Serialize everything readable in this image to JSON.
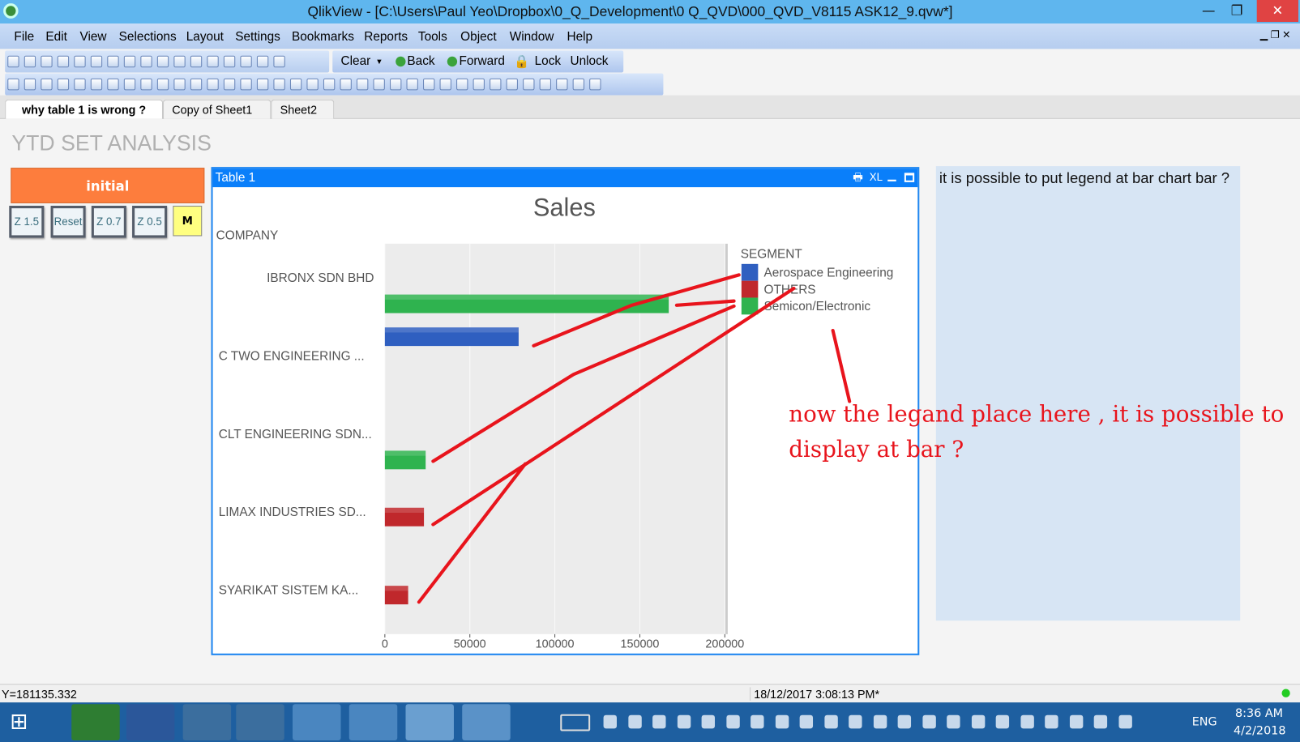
{
  "window": {
    "title": "QlikView - [C:\\Users\\Paul Yeo\\Dropbox\\0_Q_Development\\0 Q_QVD\\000_QVD_V8115 ASK12_9.qvw*]",
    "minimize": "—",
    "restore": "❐",
    "close": "✕"
  },
  "menu": [
    "File",
    "Edit",
    "View",
    "Selections",
    "Layout",
    "Settings",
    "Bookmarks",
    "Reports",
    "Tools",
    "Object",
    "Window",
    "Help"
  ],
  "toolbar": {
    "clear": "Clear",
    "back": "Back",
    "forward": "Forward",
    "lock": "Lock",
    "unlock": "Unlock"
  },
  "tabs": [
    "why table 1 is wrong ?",
    "Copy of Sheet1",
    "Sheet2"
  ],
  "sheet": {
    "title": "YTD SET ANALYSIS",
    "initial_button": "initial",
    "buttons": [
      "Z 1.5",
      "Reset",
      "Z 0.7",
      "Z 0.5"
    ],
    "m_button": "M"
  },
  "chart_object": {
    "caption": "Table 1",
    "caption_icons": [
      "print-icon",
      "XL",
      "minimize-icon",
      "maximize-icon"
    ],
    "xl": "XL"
  },
  "chart_data": {
    "type": "bar",
    "orientation": "horizontal",
    "title": "Sales",
    "ylabel": "COMPANY",
    "legend_title": "SEGMENT",
    "legend_placement": "right",
    "categories": [
      "IBRONX SDN BHD",
      "C TWO ENGINEERING ...",
      "CLT ENGINEERING SDN...",
      "LIMAX INDUSTRIES SD...",
      "SYARIKAT SISTEM KA..."
    ],
    "xticks": [
      "0",
      "50000",
      "100000",
      "150000",
      "200000"
    ],
    "xlim": [
      0,
      200000
    ],
    "grid": true,
    "series": [
      {
        "name": "Aerospace Engineering",
        "color": "#2f5fc0",
        "values": [
          78700,
          null,
          null,
          null,
          null
        ]
      },
      {
        "name": "OTHERS",
        "color": "#c0282c",
        "values": [
          null,
          null,
          null,
          23000,
          13700
        ]
      },
      {
        "name": "Semicon/Electronic",
        "color": "#2fb34f",
        "values": [
          167000,
          null,
          24000,
          null,
          null
        ]
      }
    ]
  },
  "annotation": {
    "line1": "now the legand place here , it is possible to",
    "line2": "display at bar ?",
    "color": "#e8141c"
  },
  "note": {
    "text": "it is possible to put legend at bar chart bar ?"
  },
  "status": {
    "left": "Y=181135.332",
    "date": "18/12/2017 3:08:13 PM*"
  },
  "taskbar": {
    "lang": "ENG",
    "time": "8:36 AM",
    "date": "4/2/2018"
  }
}
